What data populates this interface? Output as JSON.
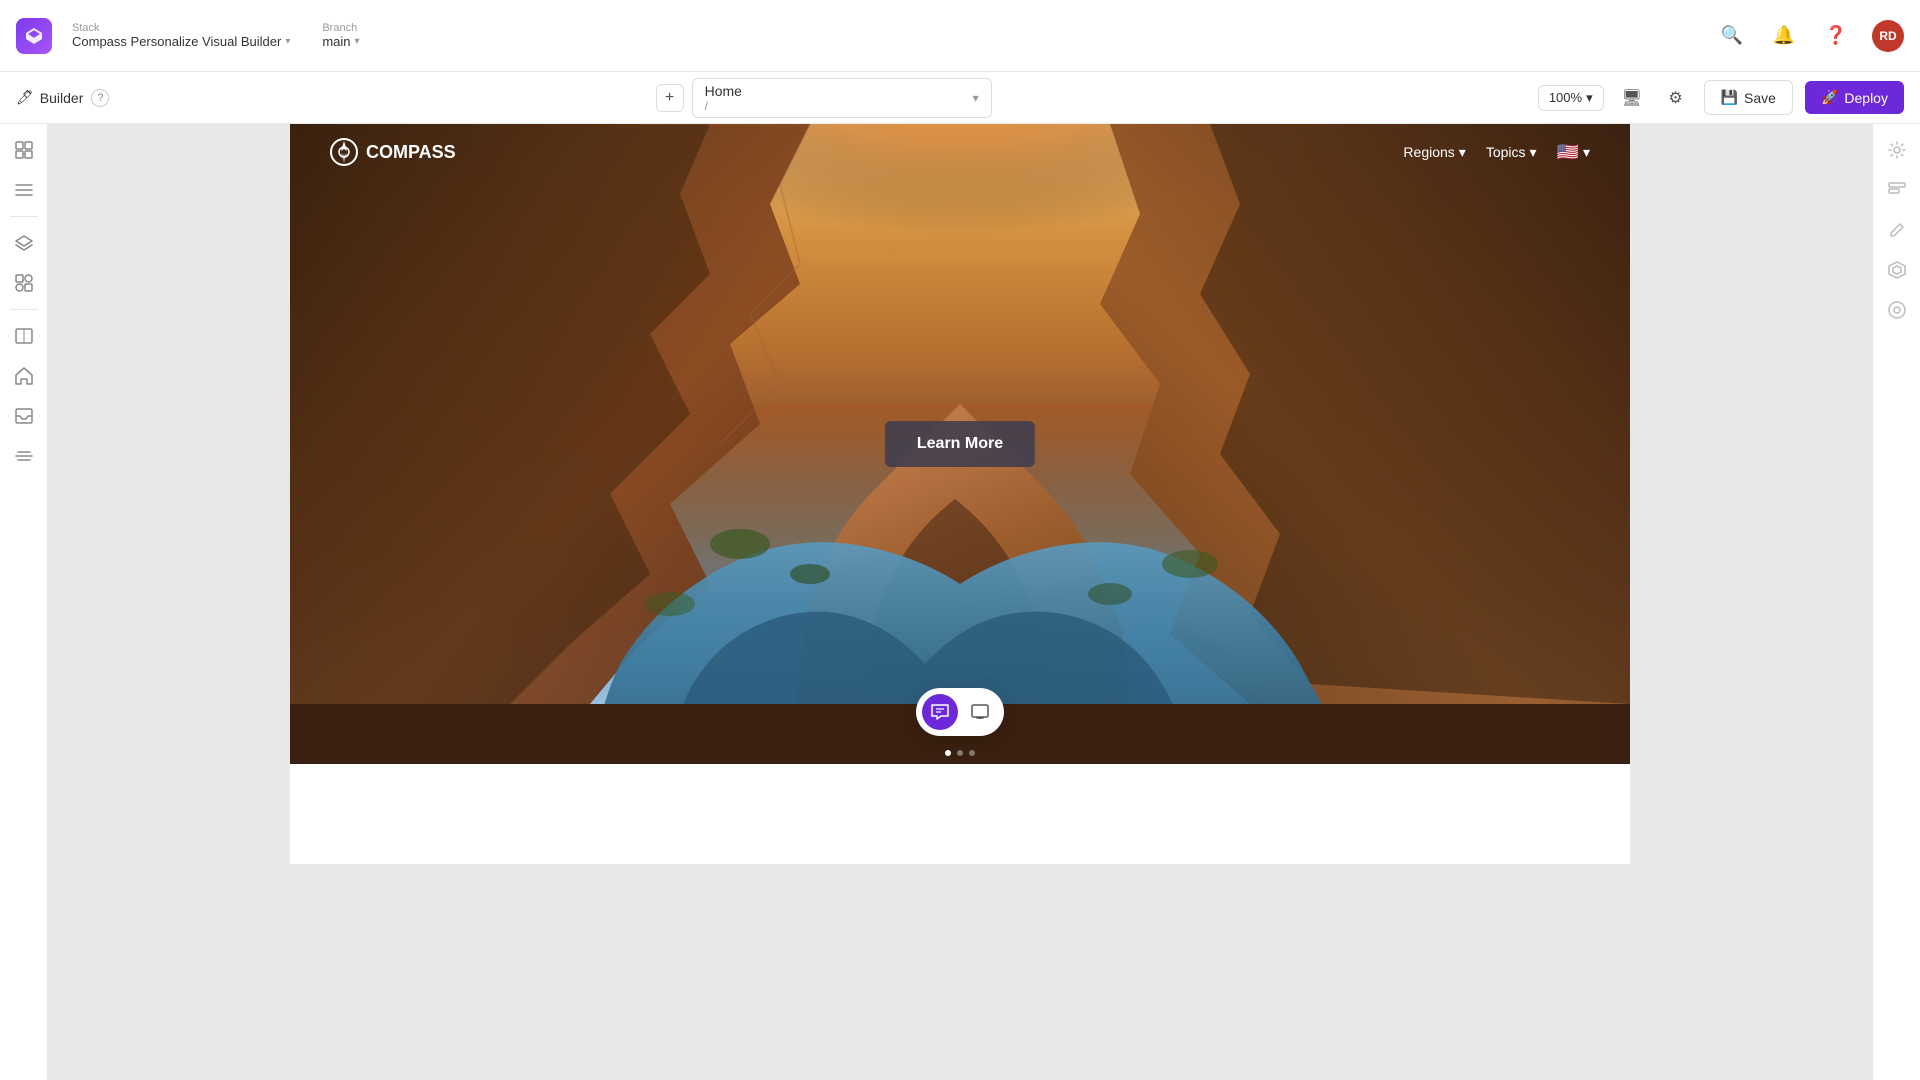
{
  "app": {
    "title": "Compass Personalize Visual Builder"
  },
  "header": {
    "stack_label": "Stack",
    "stack_value": "Compass Personalize Visual Builder",
    "branch_label": "Branch",
    "branch_value": "main",
    "search_tooltip": "Search",
    "notifications_tooltip": "Notifications",
    "help_tooltip": "Help",
    "avatar_initials": "RD"
  },
  "toolbar": {
    "builder_label": "Builder",
    "add_button": "+",
    "page_name": "Home",
    "page_path": "/",
    "zoom_value": "100%",
    "save_label": "Save",
    "deploy_label": "Deploy"
  },
  "sidebar": {
    "icons": [
      {
        "name": "grid-icon",
        "symbol": "⊞",
        "active": false
      },
      {
        "name": "list-icon",
        "symbol": "≡",
        "active": false
      },
      {
        "name": "layers-icon",
        "symbol": "◫",
        "active": false
      },
      {
        "name": "components-icon",
        "symbol": "⊕",
        "active": false
      },
      {
        "name": "responsive-icon",
        "symbol": "⇔",
        "active": false
      },
      {
        "name": "home-icon",
        "symbol": "⌂",
        "active": false
      },
      {
        "name": "inbox-icon",
        "symbol": "⊟",
        "active": false
      },
      {
        "name": "settings-icon",
        "symbol": "⚙",
        "active": false
      }
    ]
  },
  "right_sidebar": {
    "icons": [
      {
        "name": "panel-icon-1",
        "symbol": "◉"
      },
      {
        "name": "panel-icon-2",
        "symbol": "▤"
      },
      {
        "name": "panel-icon-3",
        "symbol": "✎"
      },
      {
        "name": "panel-icon-4",
        "symbol": "⬡"
      },
      {
        "name": "panel-icon-5",
        "symbol": "◈"
      }
    ]
  },
  "website": {
    "logo_text": "COMPASS",
    "nav_regions": "Regions",
    "nav_topics": "Topics",
    "learn_more_label": "Learn More"
  },
  "bottom_toolbar": {
    "comment_tool": "💬",
    "preview_tool": "📱"
  },
  "colors": {
    "primary": "#6d28d9",
    "deploy_bg": "#6d28d9",
    "save_border": "#ddd"
  }
}
